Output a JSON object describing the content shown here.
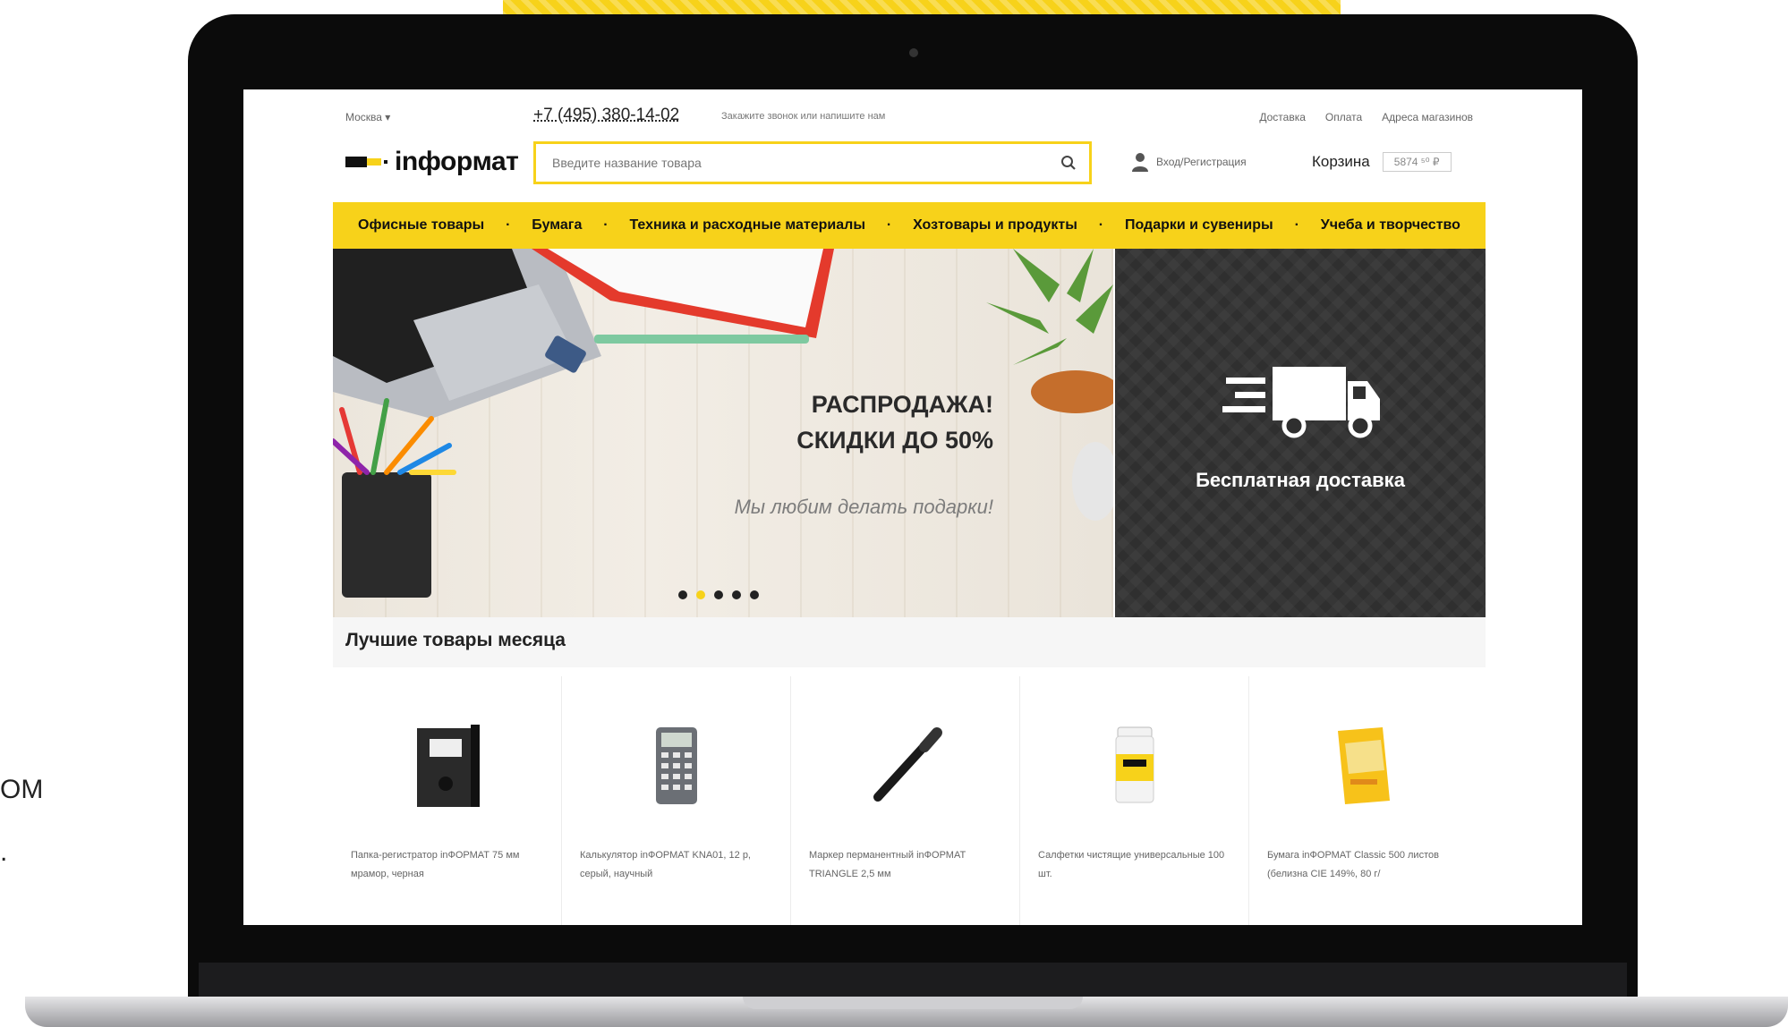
{
  "top_bar": {
    "city": "Москва ▾",
    "phone": "+7 (495) 380-14-02",
    "callback": "Закажите звонок или напишите нам",
    "links": [
      "Доставка",
      "Оплата",
      "Адреса магазинов"
    ]
  },
  "header": {
    "logo_text": "іnфоpмат",
    "search_placeholder": "Введите название товара",
    "login_label": "Вход/Регистрация",
    "cart_label": "Корзина",
    "cart_sum": "5874 ⁵⁰ ₽"
  },
  "nav": [
    "Офисные товары",
    "Бумага",
    "Техника и расходные материалы",
    "Хозтовары и продукты",
    "Подарки и сувениры",
    "Учеба и творчество"
  ],
  "banner": {
    "title_line1": "РАСПРОДАЖА!",
    "title_line2": "СКИДКИ ДО 50%",
    "subtitle": "Мы любим делать подарки!",
    "dots_count": 5,
    "active_dot": 1
  },
  "promo": {
    "label": "Бесплатная доставка"
  },
  "best": {
    "title": "Лучшие товары месяца",
    "products": [
      {
        "title": "Папка-регистратор inФОРМАТ 75 мм мрамор, черная",
        "icon": "binder-icon"
      },
      {
        "title": "Калькулятор inФОРМАТ KNA01, 12 р, серый, научный",
        "icon": "calculator-icon"
      },
      {
        "title": "Маркер перманентный inФОРМАТ TRIANGLE 2,5 мм",
        "icon": "marker-icon"
      },
      {
        "title": "Салфетки чистящие универсальные 100 шт.",
        "icon": "wipes-icon"
      },
      {
        "title": "Бумага inФОРМАТ Classic 500 листов (белизна CIE 149%, 80 г/",
        "icon": "paper-pack-icon"
      }
    ]
  },
  "side_text": [
    "ОМ",
    "."
  ],
  "colors": {
    "accent": "#f7d21a",
    "dark": "#2f2f2f"
  }
}
